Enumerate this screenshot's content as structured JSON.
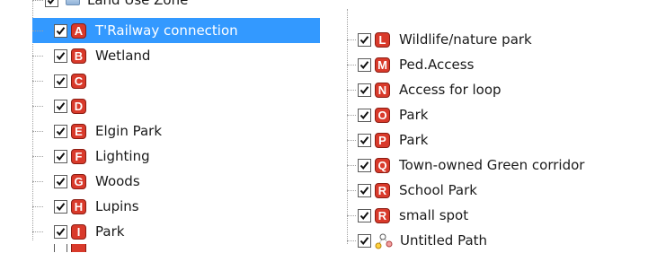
{
  "left_panel": {
    "top_partial_row": {
      "label": "Land Use Zone",
      "checked": true
    },
    "items": [
      {
        "letter": "A",
        "label": "T'Railway connection",
        "checked": true,
        "selected": true
      },
      {
        "letter": "B",
        "label": "Wetland",
        "checked": true,
        "selected": false
      },
      {
        "letter": "C",
        "label": "",
        "checked": true,
        "selected": false
      },
      {
        "letter": "D",
        "label": "",
        "checked": true,
        "selected": false
      },
      {
        "letter": "E",
        "label": "Elgin Park",
        "checked": true,
        "selected": false
      },
      {
        "letter": "F",
        "label": "Lighting",
        "checked": true,
        "selected": false
      },
      {
        "letter": "G",
        "label": "Woods",
        "checked": true,
        "selected": false
      },
      {
        "letter": "H",
        "label": "Lupins",
        "checked": true,
        "selected": false
      },
      {
        "letter": "I",
        "label": "Park",
        "checked": true,
        "selected": false
      }
    ]
  },
  "right_panel": {
    "items": [
      {
        "letter": "L",
        "label": "Wildlife/nature park",
        "checked": true
      },
      {
        "letter": "M",
        "label": "Ped.Access",
        "checked": true
      },
      {
        "letter": "N",
        "label": "Access for loop",
        "checked": true
      },
      {
        "letter": "O",
        "label": "Park",
        "checked": true
      },
      {
        "letter": "P",
        "label": "Park",
        "checked": true
      },
      {
        "letter": "Q",
        "label": "Town-owned Green corridor",
        "checked": true
      },
      {
        "letter": "R",
        "label": "School Park",
        "checked": true
      },
      {
        "letter": "R",
        "label": "small spot",
        "checked": true
      },
      {
        "icon": "path-icon",
        "label": "Untitled Path",
        "checked": true
      }
    ]
  },
  "colors": {
    "selection": "#3399ff",
    "marker_fill": "#d93a2b",
    "marker_border": "#8b1c12"
  }
}
